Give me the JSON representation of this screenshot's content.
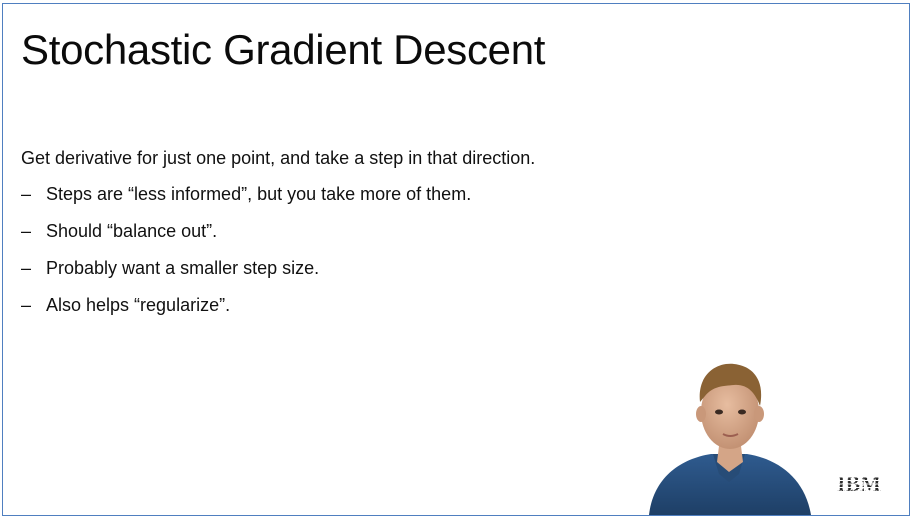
{
  "slide": {
    "title": "Stochastic Gradient Descent",
    "lead": "Get derivative for just one point, and take a step in that direction.",
    "bullet_marker": "–",
    "bullets": [
      "Steps are “less informed”, but you take more of them.",
      "Should “balance out”.",
      "Probably want a smaller step size.",
      "Also helps “regularize”."
    ]
  },
  "logo": {
    "text": "IBM",
    "color": "#2b2b2b"
  },
  "colors": {
    "frame_border": "#4f7fc0",
    "background": "#ffffff",
    "text": "#111111"
  }
}
